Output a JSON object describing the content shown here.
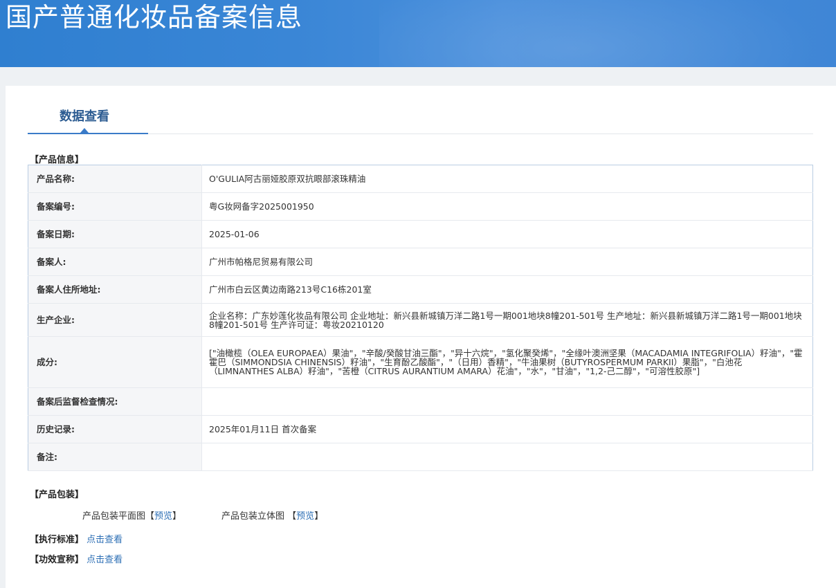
{
  "header": {
    "title": "国产普通化妆品备案信息"
  },
  "tab": {
    "label": "数据查看"
  },
  "product_section": {
    "title": "【产品信息】"
  },
  "rows": [
    {
      "key": "产品名称:",
      "value": "O'GULIA阿古丽娅胶原双抗眼部滚珠精油"
    },
    {
      "key": "备案编号:",
      "value": "粤G妆网备字2025001950"
    },
    {
      "key": "备案日期:",
      "value": "2025-01-06"
    },
    {
      "key": "备案人:",
      "value": "广州市帕格尼贸易有限公司"
    },
    {
      "key": "备案人住所地址:",
      "value": "广州市白云区黄边南路213号C16栋201室"
    },
    {
      "key": "生产企业:",
      "value": "企业名称：广东妙莲化妆品有限公司 企业地址：新兴县新城镇万洋二路1号一期001地块8幢201-501号 生产地址：新兴县新城镇万洋二路1号一期001地块8幢201-501号 生产许可证：粤妆20210120"
    },
    {
      "key": "成分:",
      "value": "[\"油橄榄（OLEA EUROPAEA）果油\"，\"辛酸/癸酸甘油三酯\"，\"异十六烷\"，\"氢化聚癸烯\"，\"全缘叶澳洲坚果（MACADAMIA INTEGRIFOLIA）籽油\"，\"霍霍巴（SIMMONDSIA CHINENSIS）籽油\"，\"生育酚乙酸酯\"，\"（日用）香精\"，\"牛油果树（BUTYROSPERMUM PARKII）果脂\"，\"白池花（LIMNANTHES ALBA）籽油\"，\"苦橙（CITRUS AURANTIUM AMARA）花油\"，\"水\"，\"甘油\"，\"1,2-己二醇\"，\"可溶性胶原\"]"
    },
    {
      "key": "备案后监督检查情况:",
      "value": ""
    },
    {
      "key": "历史记录:",
      "value": "2025年01月11日 首次备案"
    },
    {
      "key": "备注:",
      "value": ""
    }
  ],
  "packaging": {
    "title": "【产品包装】",
    "flat_label": "产品包装平面图",
    "solid_label": "产品包装立体图",
    "preview_link": "预览",
    "bracket_open": "【",
    "bracket_close": "】"
  },
  "standard": {
    "title": "【执行标准】",
    "link": "点击查看"
  },
  "efficacy": {
    "title": "【功效宣称】",
    "link": "点击查看"
  }
}
